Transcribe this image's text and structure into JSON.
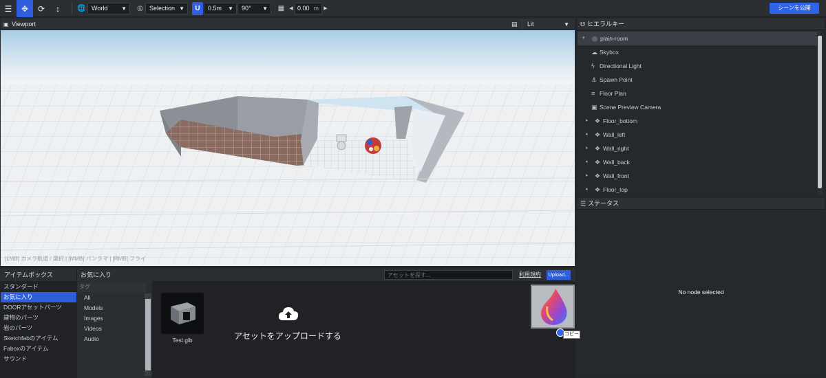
{
  "toolbar": {
    "space_select": "World",
    "pivot_select": "Selection",
    "snap_distance": "0.5m",
    "snap_angle": "90°",
    "grid_value": "0.00",
    "grid_unit": "m",
    "publish_label": "シーンを公開"
  },
  "viewport": {
    "title": "Viewport",
    "render_mode": "Lit",
    "help_text": "[LMB] カメラ軌道 / 選択 | [MMB] パンラマ | [RMB] フライ"
  },
  "hierarchy": {
    "title": "ヒエラルキー",
    "items": [
      {
        "label": "plain-room",
        "icon": "globe-icon",
        "expander": "▾",
        "indent": 0
      },
      {
        "label": "Skybox",
        "icon": "cloud-icon",
        "expander": "",
        "indent": 1
      },
      {
        "label": "Directional Light",
        "icon": "bolt-icon",
        "expander": "",
        "indent": 1
      },
      {
        "label": "Spawn Point",
        "icon": "spawn-icon",
        "expander": "",
        "indent": 1
      },
      {
        "label": "Floor Plan",
        "icon": "stairs-icon",
        "expander": "",
        "indent": 1
      },
      {
        "label": "Scene Preview Camera",
        "icon": "camera-icon",
        "expander": "",
        "indent": 1
      },
      {
        "label": "Floor_bottom",
        "icon": "cubes-icon",
        "expander": "▸",
        "indent": 1
      },
      {
        "label": "Wall_left",
        "icon": "cubes-icon",
        "expander": "▸",
        "indent": 1
      },
      {
        "label": "Wall_right",
        "icon": "cubes-icon",
        "expander": "▸",
        "indent": 1
      },
      {
        "label": "Wall_back",
        "icon": "cubes-icon",
        "expander": "▸",
        "indent": 1
      },
      {
        "label": "Wall_front",
        "icon": "cubes-icon",
        "expander": "▸",
        "indent": 1
      },
      {
        "label": "Floor_top",
        "icon": "cubes-icon",
        "expander": "▸",
        "indent": 1
      }
    ]
  },
  "status": {
    "title": "ステータス",
    "empty_text": "No node selected"
  },
  "itembox": {
    "title": "アイテムボックス",
    "current_section": "お気に入り",
    "search_placeholder": "アセットを探す...",
    "terms_label": "利用規約",
    "upload_button": "Upload...",
    "categories": [
      "スタンダード",
      "お気に入り",
      "DOORアセットパーツ",
      "建物のパーツ",
      "岩のパーツ",
      "Sketchfabのアイテム",
      "Faboxのアイテム",
      "サウンド"
    ],
    "selected_category": 1,
    "tags_header": "タグ",
    "tags": [
      "All",
      "Models",
      "Images",
      "Videos",
      "Audio"
    ],
    "asset_name": "Test.glb",
    "upload_prompt": "アセットをアップロードする",
    "copy_tooltip": "コピー"
  }
}
